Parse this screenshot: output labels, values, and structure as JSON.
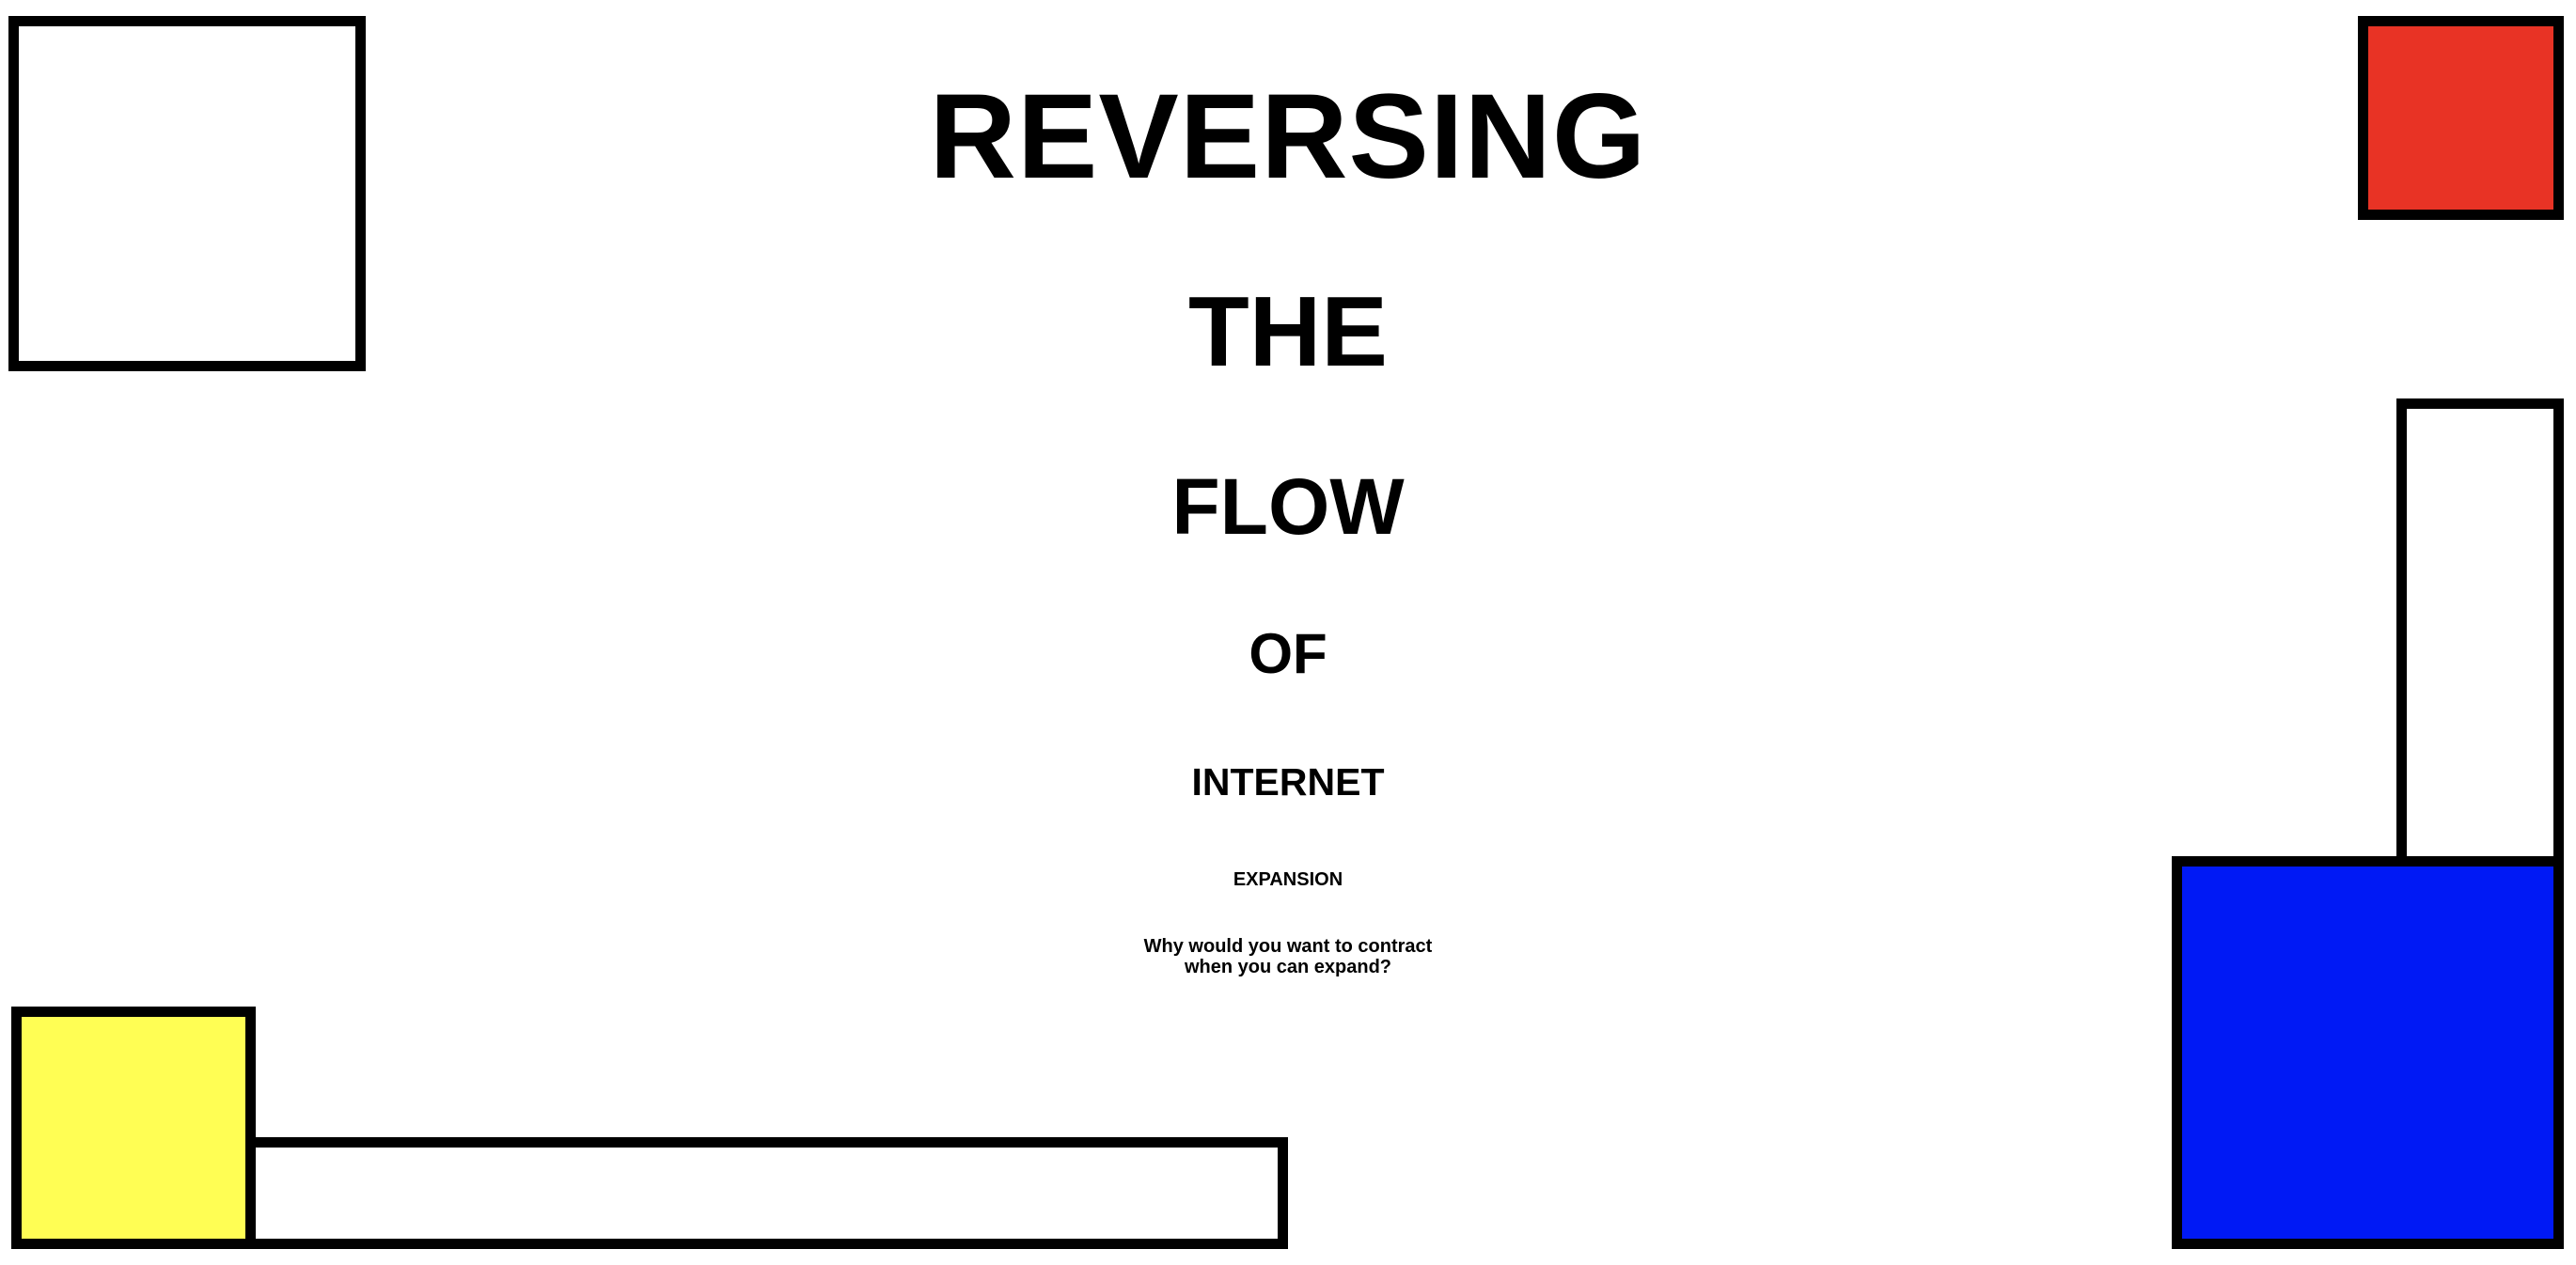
{
  "title": {
    "words": [
      "REVERSING",
      "THE",
      "FLOW",
      "OF",
      "INTERNET",
      "EXPANSION"
    ]
  },
  "tagline": {
    "line1": "Why would you want to contract",
    "line2": "when you can expand?"
  },
  "colors": {
    "background": "#ffffff",
    "border": "#000000",
    "red": "#e83325",
    "blue": "#0019f5",
    "yellow": "#fffe54"
  }
}
